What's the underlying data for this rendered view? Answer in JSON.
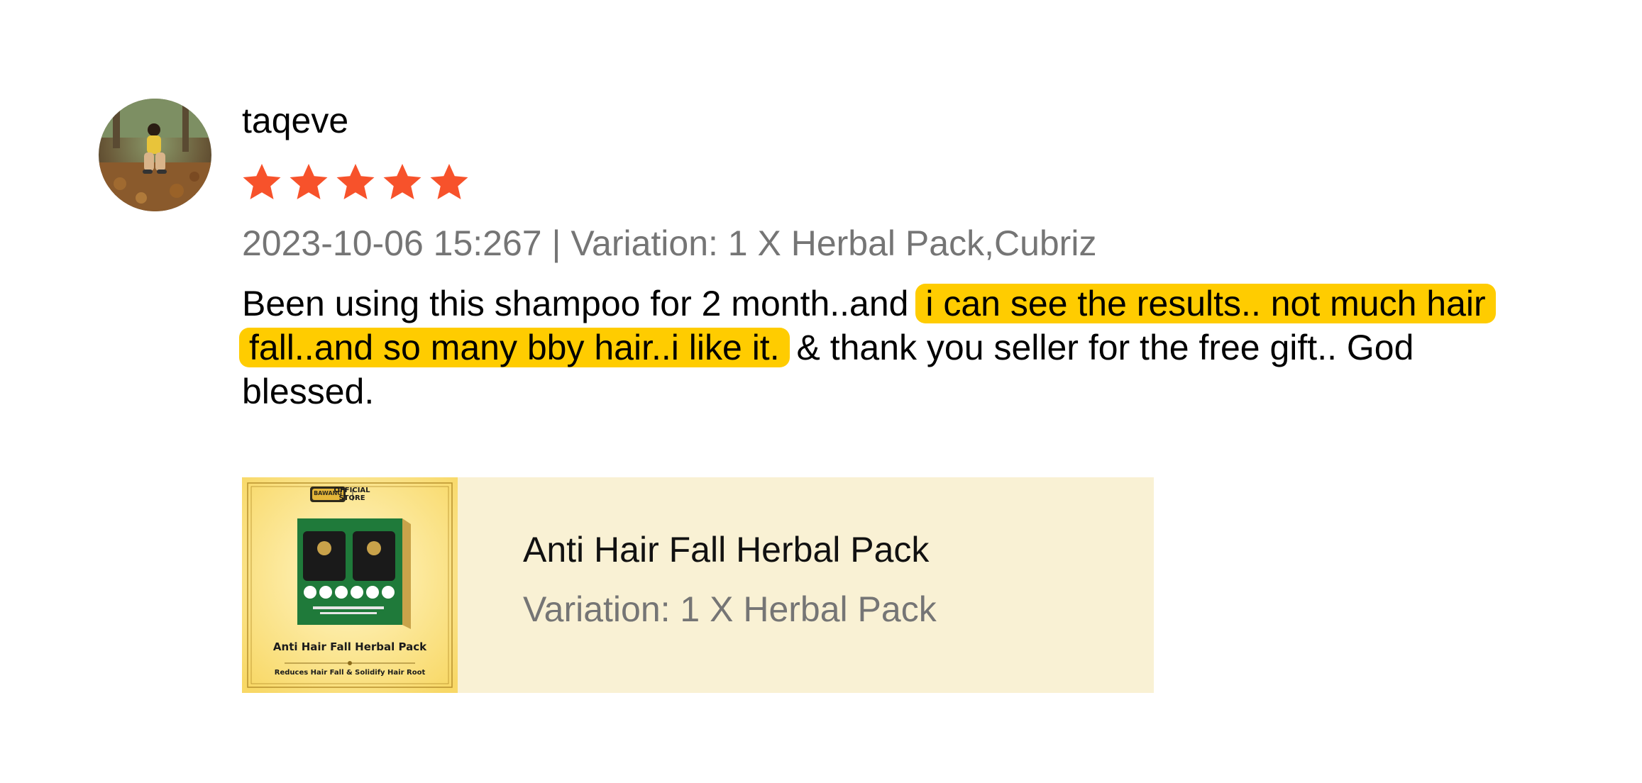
{
  "review": {
    "username": "taqeve",
    "rating": 5,
    "rating_max": 5,
    "date": "2023-10-06 15:267",
    "separator": " | ",
    "variation_label": "Variation: 1 X Herbal Pack,Cubriz",
    "text_before": "Been using this shampoo for 2 month..and ",
    "text_highlight": "i can see the results.. not much hair fall..and so many bby hair..i like it.",
    "text_after": " & thank you seller for the free gift.. God blessed."
  },
  "product": {
    "title": "Anti Hair Fall Herbal Pack",
    "variation": "Variation: 1 X Herbal Pack",
    "thumb": {
      "brand": "BAWANG",
      "store": "OFFICIAL STORE",
      "name": "Anti Hair Fall Herbal Pack",
      "tagline": "Reduces Hair Fall & Solidify Hair Root"
    }
  },
  "colors": {
    "star": "#f7522b",
    "highlight": "#ffcc00",
    "meta_text": "#757575",
    "card_bg": "#f9f1d4"
  },
  "icons": {
    "star": "star-icon",
    "avatar": "user-avatar-photo"
  }
}
